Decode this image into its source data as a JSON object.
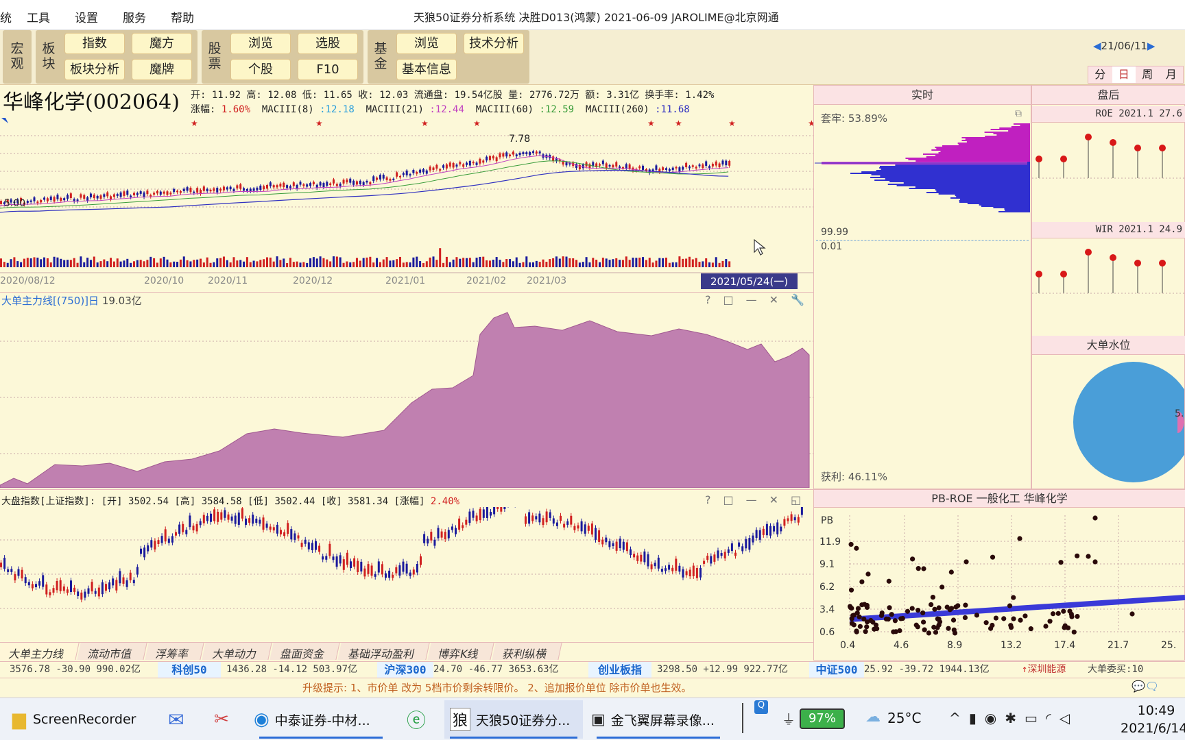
{
  "menu": {
    "items": [
      "工具",
      "设置",
      "服务",
      "帮助"
    ],
    "prefix": "统"
  },
  "app_title": "天狼50证券分析系统  决胜D013(鸿蒙)  2021-06-09 JAROLIME@北京网通",
  "toolbar": {
    "groups": [
      {
        "label": "宏观",
        "buttons": []
      },
      {
        "label": "板块",
        "buttons": [
          "指数",
          "魔方",
          "板块分析",
          "魔牌"
        ]
      },
      {
        "label": "股票",
        "buttons": [
          "浏览",
          "选股",
          "个股",
          "F10"
        ]
      },
      {
        "label": "基金",
        "buttons": [
          "浏览",
          "技术分析",
          "基本信息"
        ]
      }
    ],
    "date": "21/06/11",
    "periods": [
      "分",
      "日",
      "周",
      "月"
    ]
  },
  "stock": {
    "name": "华峰化学(002064)",
    "info_line1": "开: 11.92 高: 12.08 低: 11.65 收: 12.03 流通盘: 19.54亿股 量: 2776.72万 额: 3.31亿 换手率: 1.42%",
    "change_label": "涨幅: ",
    "change_value": "1.60%",
    "macd": [
      {
        "label": "MACIII(8)",
        "value": ":12.18",
        "color": "#2a9edc"
      },
      {
        "label": "MACIII(21)",
        "value": ":12.44",
        "color": "#c040c0"
      },
      {
        "label": "MACIII(60)",
        "value": ":12.59",
        "color": "#3a9c3a"
      },
      {
        "label": "MACIII(260)",
        "value": ":11.68",
        "color": "#3030c0"
      }
    ],
    "price_high_label": "7.78",
    "price_low_label": "5.00",
    "date_axis": [
      "2020/08/12",
      "2020/10",
      "2020/11",
      "2020/12",
      "2021/01",
      "2021/02",
      "2021/03"
    ],
    "selected_date": "2021/05/24(一)"
  },
  "panel_dadan": {
    "title": "大单主力线[(750)]日",
    "value": "19.03亿",
    "tools": [
      "?",
      "□",
      "—",
      "✕",
      "🔧"
    ]
  },
  "panel_index": {
    "title": "大盘指数[上证指数]:",
    "values": "[开] 3502.54 [高] 3584.58 [低] 3502.44 [收] 3581.34 [涨幅]",
    "change": "2.40%",
    "tools": [
      "?",
      "□",
      "—",
      "✕",
      "◱"
    ]
  },
  "bottom_tabs": [
    "大单主力线",
    "流动市值",
    "浮筹率",
    "大单动力",
    "盘面资金",
    "基础浮动盈利",
    "博弈K线",
    "获利纵横"
  ],
  "quotes": [
    {
      "name": "",
      "vals": "3576.78   -30.90   990.02亿"
    },
    {
      "name": "科创50",
      "vals": "1436.28   -14.12   503.97亿"
    },
    {
      "name": "沪深300",
      "vals": "24.70   -46.77   3653.63亿"
    },
    {
      "name": "创业板指",
      "vals": "3298.50   +12.99   922.77亿"
    },
    {
      "name": "中证500",
      "vals": "25.92   -39.72   1944.13亿"
    }
  ],
  "quote_extra": {
    "left": "深圳能源",
    "right": "大单委买:10"
  },
  "tip": "升级提示: 1、市价单 改为 5档市价剩余转限价。 2、追加报价单位 除市价单也生效。",
  "realtime": {
    "header": "实时",
    "tao": "套牢: 53.89%",
    "p_high": "99.99",
    "p_low": "0.01",
    "profit": "获利: 46.11%"
  },
  "after": {
    "header": "盘后",
    "roe": "ROE 2021.1 27.6",
    "wir": "WIR 2021.1 24.9",
    "water_title": "大单水位",
    "water_label": "5."
  },
  "pbroe": {
    "title": "PB-ROE  一般化工  华峰化学",
    "ylabel": "PB",
    "yticks": [
      "11.9",
      "9.1",
      "6.2",
      "3.4",
      "0.6"
    ],
    "xticks": [
      "0.4",
      "4.6",
      "8.9",
      "13.2",
      "17.4",
      "21.7",
      "25."
    ]
  },
  "taskbar": {
    "items": [
      {
        "label": "ScreenRecorder",
        "icon": "folder-icon"
      },
      {
        "label": "",
        "icon": "mail-icon"
      },
      {
        "label": "",
        "icon": "tool-icon"
      },
      {
        "label": "中泰证券-中材...",
        "icon": "edge-icon"
      },
      {
        "label": "",
        "icon": "ie-icon"
      },
      {
        "label": "天狼50证券分...",
        "icon": "app-icon"
      },
      {
        "label": "金飞翼屏幕录像...",
        "icon": "recorder-icon"
      }
    ],
    "battery": "97%",
    "weather": "25°C",
    "time": "10:49",
    "date": "2021/6/14"
  },
  "colors": {
    "bg": "#fcf8d8",
    "accent": "#c080b0",
    "up": "#d02020",
    "down": "#1a1a9c"
  }
}
